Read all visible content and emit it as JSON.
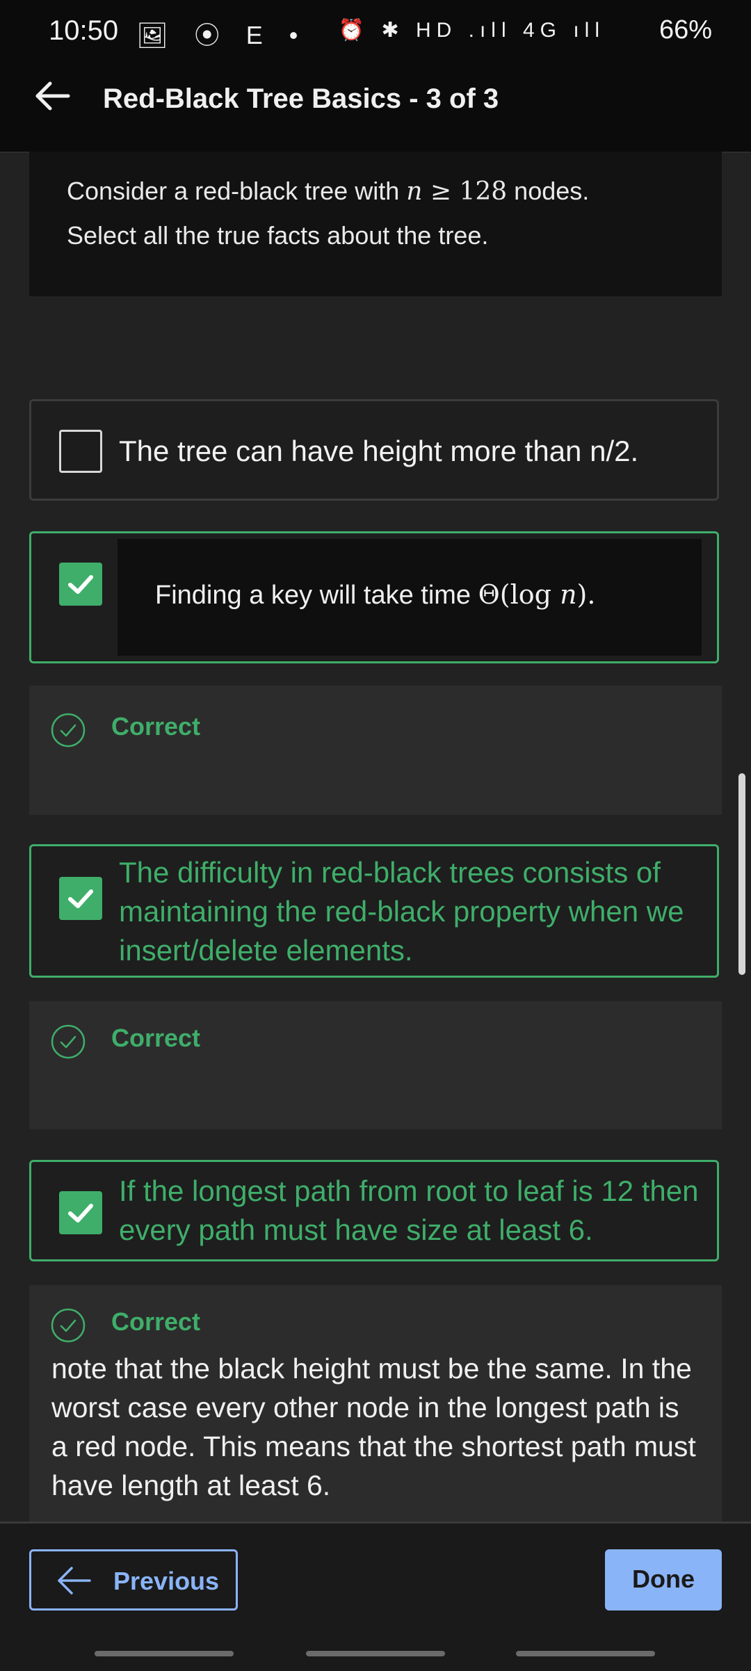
{
  "status_bar": {
    "time": "10:50",
    "left_icons": "🖼 ⦿ E •",
    "right_icons": "⏰ ✱ HD .ıll 4G ıll",
    "battery": "66%"
  },
  "app_bar": {
    "title": "Red-Black Tree Basics - 3 of 3"
  },
  "question": {
    "line1_before": "Consider a red-black tree with ",
    "line1_math_var": "n",
    "line1_math_rest": " ≥ 128",
    "line1_after": " nodes.",
    "line2": "Select all the true facts about the tree."
  },
  "options": [
    {
      "text": "The tree can have height more than n/2.",
      "checked": false
    },
    {
      "text_before": "Finding a key will take time ",
      "math": "Θ(log ",
      "math_var": "n",
      "math_end": ").",
      "checked": true
    },
    {
      "line1": "The difficulty in red-black trees consists of",
      "line2": "maintaining the red-black property when we",
      "line3": "insert/delete elements.",
      "checked": true
    },
    {
      "line1": "If the longest path from root to leaf is 12 then",
      "line2": "every path must have size at least 6.",
      "checked": true
    }
  ],
  "feedback": [
    {
      "label": "Correct"
    },
    {
      "label": "Correct"
    },
    {
      "label": "Correct",
      "line1": "note that the black height must be the same. In the",
      "line2": "worst case every other node in the longest path is",
      "line3": "a red node. This means that the shortest path must",
      "line4": "have length at least 6."
    }
  ],
  "nav": {
    "previous_label": "Previous",
    "done_label": "Done"
  },
  "colors": {
    "accent_green": "#3fae6a",
    "accent_blue": "#8ab4f8",
    "background": "#222222"
  }
}
